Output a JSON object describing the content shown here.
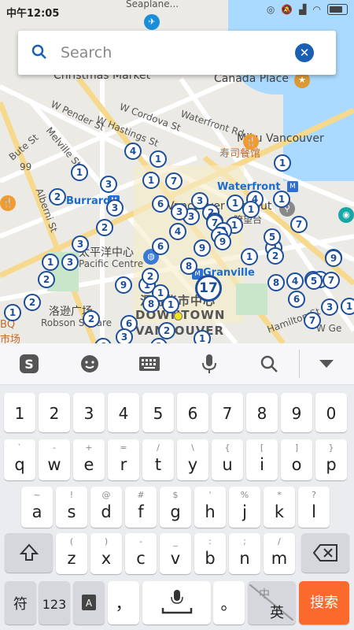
{
  "status_bar": {
    "time": "中午12:05",
    "top_label": "Seaplane..."
  },
  "search": {
    "placeholder": "Search",
    "value": ""
  },
  "map": {
    "labels": [
      {
        "text": "W Pender St",
        "style": ""
      },
      {
        "text": "W Cordova St",
        "style": ""
      },
      {
        "text": "W Hastings St",
        "style": ""
      },
      {
        "text": "Waterfront Rd",
        "style": ""
      },
      {
        "text": "Canada Place",
        "style": "big"
      },
      {
        "text": "Christmas Market",
        "style": "big"
      },
      {
        "text": "Miku Vancouver",
        "style": "big"
      },
      {
        "text": "寿司餐馆",
        "style": "orange"
      },
      {
        "text": "Burrard",
        "style": "blue"
      },
      {
        "text": "Waterfront",
        "style": "blue"
      },
      {
        "text": "Vancouver Lookout",
        "style": "big"
      },
      {
        "text": "瞭望台",
        "style": ""
      },
      {
        "text": "太平洋中心",
        "style": "big"
      },
      {
        "text": "Pacific Centre",
        "style": ""
      },
      {
        "text": "Granville",
        "style": "blue"
      },
      {
        "text": "温哥华市中心",
        "style": "dark"
      },
      {
        "text": "DOWNTOWN",
        "style": "dark"
      },
      {
        "text": "VANCOUVER",
        "style": "dark"
      },
      {
        "text": "洛逊广场",
        "style": "big"
      },
      {
        "text": "Robson Square",
        "style": ""
      },
      {
        "text": "Melville St",
        "style": ""
      },
      {
        "text": "Bute St",
        "style": ""
      },
      {
        "text": "Alberni St",
        "style": ""
      },
      {
        "text": "Hamilton St",
        "style": ""
      },
      {
        "text": "W Ge",
        "style": ""
      },
      {
        "text": "BQ",
        "style": "orange"
      },
      {
        "text": "市场",
        "style": ""
      },
      {
        "text": "99",
        "style": ""
      }
    ],
    "markers": [
      "4",
      "1",
      "3",
      "1",
      "7",
      "3",
      "2",
      "1",
      "3",
      "2",
      "1",
      "4",
      "3",
      "2",
      "1",
      "4",
      "3",
      "1",
      "7",
      "1",
      "2",
      "3",
      "2",
      "5",
      "7",
      "5",
      "4",
      "6",
      "8",
      "9",
      "1",
      "3",
      "2",
      "1",
      "2",
      "6",
      "9",
      "8",
      "1",
      "1",
      "1",
      "2",
      "3",
      "8",
      "4",
      "5",
      "6",
      "9",
      "1",
      "2",
      "1",
      "7",
      "3",
      "6",
      "1",
      "2",
      "1",
      "6",
      "3",
      "2",
      "2",
      "7",
      "3",
      "1",
      "9",
      "9"
    ],
    "big_marker": "17"
  },
  "keyboard": {
    "toolbar_icons": [
      "sogou-logo-icon",
      "emoji-icon",
      "keyboard-layout-icon",
      "microphone-icon",
      "search-icon",
      "collapse-keyboard-icon"
    ],
    "number_row": [
      "1",
      "2",
      "3",
      "4",
      "5",
      "6",
      "7",
      "8",
      "9",
      "0"
    ],
    "row1": [
      {
        "main": "q",
        "sub": "`"
      },
      {
        "main": "w",
        "sub": "-"
      },
      {
        "main": "e",
        "sub": "+"
      },
      {
        "main": "r",
        "sub": "="
      },
      {
        "main": "t",
        "sub": "/"
      },
      {
        "main": "y",
        "sub": "\\"
      },
      {
        "main": "u",
        "sub": "{"
      },
      {
        "main": "i",
        "sub": "["
      },
      {
        "main": "o",
        "sub": "]"
      },
      {
        "main": "p",
        "sub": "}"
      }
    ],
    "row2": [
      {
        "main": "a",
        "sub": "~"
      },
      {
        "main": "s",
        "sub": "!"
      },
      {
        "main": "d",
        "sub": "@"
      },
      {
        "main": "f",
        "sub": "#"
      },
      {
        "main": "g",
        "sub": "$"
      },
      {
        "main": "h",
        "sub": "'"
      },
      {
        "main": "j",
        "sub": "%"
      },
      {
        "main": "k",
        "sub": "*"
      },
      {
        "main": "l",
        "sub": "?"
      }
    ],
    "row3": [
      {
        "main": "z",
        "sub": "("
      },
      {
        "main": "x",
        "sub": ")"
      },
      {
        "main": "c",
        "sub": "-"
      },
      {
        "main": "v",
        "sub": "_"
      },
      {
        "main": "b",
        "sub": ":"
      },
      {
        "main": "n",
        "sub": ";"
      },
      {
        "main": "m",
        "sub": "/"
      }
    ],
    "bottom": {
      "symbols": "符",
      "numbers": "123",
      "comma": "，",
      "period": "。",
      "lang_top": "中",
      "lang_bottom": "英",
      "search": "搜索"
    }
  },
  "colors": {
    "marker": "#1d4e9c",
    "search_key": "#fb6a2c",
    "clear_button": "#1a5fb4"
  }
}
